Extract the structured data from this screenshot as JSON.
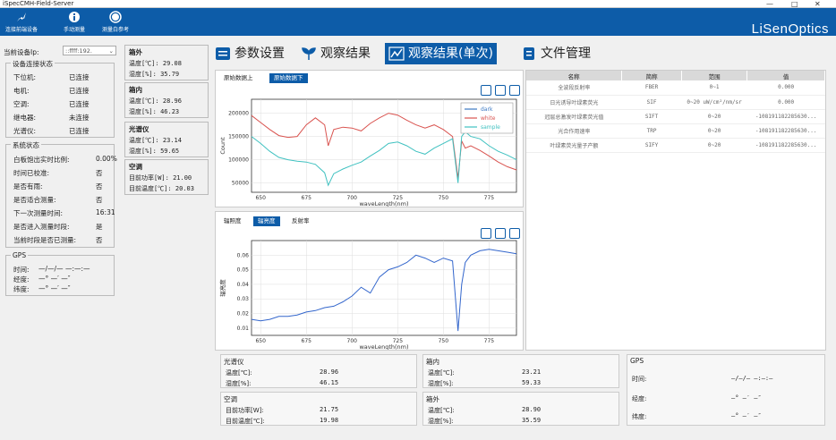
{
  "window": {
    "title": "iSpecCMH-Field-Server"
  },
  "toolbar": {
    "buttons": [
      {
        "label": "连接前端设备",
        "icon": "rocket-icon"
      },
      {
        "label": "手动测量",
        "icon": "info-icon"
      },
      {
        "label": "测量白参考",
        "icon": "circle-icon"
      }
    ],
    "logo": "LiSenOptics"
  },
  "device": {
    "label": "当前设备Ip:",
    "value": "::ffff:192."
  },
  "conn": {
    "title": "设备连接状态",
    "rows": [
      {
        "k": "下位机:",
        "v": "已连接"
      },
      {
        "k": "电机:",
        "v": "已连接"
      },
      {
        "k": "空调:",
        "v": "已连接"
      },
      {
        "k": "继电器:",
        "v": "未连接"
      },
      {
        "k": "光谱仪:",
        "v": "已连接"
      }
    ]
  },
  "sys": {
    "title": "系统状态",
    "rows": [
      {
        "k": "白板饱出实时比例:",
        "v": "0.00%"
      },
      {
        "k": "时间已校准:",
        "v": "否"
      },
      {
        "k": "是否有雨:",
        "v": "否"
      },
      {
        "k": "是否适合测量:",
        "v": "否"
      },
      {
        "k": "下一次测量时间:",
        "v": "16:31"
      },
      {
        "k": "是否进入测量时段:",
        "v": "是"
      },
      {
        "k": "当前时段是否已测量:",
        "v": "否"
      }
    ]
  },
  "gps_left": {
    "title": "GPS",
    "rows": [
      {
        "k": "时间:",
        "v": "—/—/— —:—:—"
      },
      {
        "k": "经度:",
        "v": "—° —′ —″"
      },
      {
        "k": "纬度:",
        "v": "—° —′ —″"
      }
    ]
  },
  "mid": {
    "outside": {
      "title": "箱外",
      "temp": "温度[℃]:   29.08",
      "hum": "湿度[%]:   35.79"
    },
    "inside": {
      "title": "箱内",
      "temp": "温度[℃]:   28.96",
      "hum": "湿度[%]:   46.23"
    },
    "spec": {
      "title": "光谱仪",
      "temp": "温度[℃]:   23.14",
      "hum": "湿度[%]:   59.65"
    },
    "ac": {
      "title": "空调",
      "power": "目前功率[W]:    21.00",
      "temp": "目前温度[℃]:   20.03"
    }
  },
  "tabs": [
    {
      "label": "参数设置",
      "icon": "sliders-icon"
    },
    {
      "label": "观察结果",
      "icon": "plant-icon"
    },
    {
      "label": "观察结果(单次)",
      "icon": "linechart-icon"
    },
    {
      "label": "文件管理",
      "icon": "file-icon"
    }
  ],
  "upper_chart": {
    "subtabs": [
      "原始数据上",
      "原始数据下"
    ],
    "legend": [
      "dark",
      "white",
      "sample"
    ]
  },
  "lower_chart": {
    "subtabs": [
      "辐照度",
      "辐亮度",
      "反射率"
    ]
  },
  "params_table": {
    "headers": [
      "名称",
      "简称",
      "范围",
      "值"
    ],
    "rows": [
      {
        "name": "全波段反射率",
        "abbr": "FBER",
        "range": "0~1",
        "value": "0.000"
      },
      {
        "name": "日光诱导叶绿素荧光",
        "abbr": "SIF",
        "range": "0~20 uW/cm²/nm/sr",
        "value": "0.000"
      },
      {
        "name": "冠层总激发叶绿素荧光值",
        "abbr": "SIFT",
        "range": "0~20",
        "value": "-108191182285630..."
      },
      {
        "name": "光合作用速率",
        "abbr": "TRP",
        "range": "0~20",
        "value": "-108191182285630..."
      },
      {
        "name": "叶绿素荧光量子产额",
        "abbr": "SIFY",
        "range": "0~20",
        "value": "-108191182285630..."
      }
    ]
  },
  "bottom": {
    "spec": {
      "title": "光谱仪",
      "r1k": "温度[℃]:",
      "r1v": "28.96",
      "r2k": "湿度[%]:",
      "r2v": "46.15"
    },
    "ac": {
      "title": "空调",
      "r1k": "目前功率[W]:",
      "r1v": "21.75",
      "r2k": "目前温度[℃]:",
      "r2v": "19.98"
    },
    "inside": {
      "title": "箱内",
      "r1k": "温度[℃]:",
      "r1v": "23.21",
      "r2k": "湿度[%]:",
      "r2v": "59.33"
    },
    "outside": {
      "title": "箱外",
      "r1k": "温度[℃]:",
      "r1v": "28.90",
      "r2k": "湿度[%]:",
      "r2v": "35.59"
    },
    "gps": {
      "title": "GPS",
      "r1k": "时间:",
      "r1v": "—/—/— —:—:—",
      "r2k": "经度:",
      "r2v": "—° —′ —″",
      "r3k": "纬度:",
      "r3v": "—° —′ —″"
    }
  },
  "colors": {
    "accent": "#0d5ca8",
    "dark": "#3a78c2",
    "white": "#d9534f",
    "sample": "#3fc1c0",
    "single": "#3366cc"
  },
  "chart_data": [
    {
      "type": "line",
      "xlabel": "waveLength(nm)",
      "ylabel": "Count",
      "xlim": [
        645,
        790
      ],
      "ylim": [
        30000,
        230000
      ],
      "xticks": [
        650,
        675,
        700,
        725,
        750,
        775
      ],
      "yticks": [
        50000,
        100000,
        150000,
        200000
      ],
      "series": [
        {
          "name": "white",
          "x": [
            645,
            650,
            655,
            660,
            665,
            670,
            675,
            680,
            685,
            687,
            690,
            695,
            700,
            705,
            710,
            715,
            720,
            725,
            730,
            735,
            740,
            745,
            750,
            755,
            758,
            760,
            762,
            765,
            770,
            775,
            780,
            785,
            790
          ],
          "y": [
            195000,
            180000,
            165000,
            152000,
            148000,
            150000,
            175000,
            190000,
            175000,
            130000,
            165000,
            170000,
            168000,
            162000,
            178000,
            190000,
            200000,
            196000,
            185000,
            175000,
            168000,
            175000,
            165000,
            150000,
            60000,
            140000,
            125000,
            130000,
            120000,
            108000,
            95000,
            85000,
            78000
          ]
        },
        {
          "name": "sample",
          "x": [
            645,
            650,
            655,
            660,
            665,
            670,
            675,
            680,
            685,
            687,
            690,
            695,
            700,
            705,
            710,
            715,
            720,
            725,
            730,
            735,
            740,
            745,
            750,
            755,
            758,
            760,
            762,
            765,
            770,
            775,
            780,
            785,
            790
          ],
          "y": [
            150000,
            135000,
            118000,
            105000,
            100000,
            97000,
            95000,
            90000,
            72000,
            45000,
            70000,
            80000,
            88000,
            95000,
            108000,
            120000,
            135000,
            138000,
            130000,
            118000,
            112000,
            125000,
            135000,
            145000,
            50000,
            150000,
            160000,
            150000,
            145000,
            130000,
            118000,
            110000,
            100000
          ]
        }
      ]
    },
    {
      "type": "line",
      "xlabel": "waveLength(nm)",
      "ylabel": "辐亮度",
      "xlim": [
        645,
        790
      ],
      "ylim": [
        0.005,
        0.07
      ],
      "xticks": [
        650,
        675,
        700,
        725,
        750,
        775
      ],
      "yticks": [
        0.01,
        0.02,
        0.03,
        0.04,
        0.05,
        0.06
      ],
      "series": [
        {
          "name": "radiance",
          "x": [
            645,
            650,
            655,
            660,
            665,
            670,
            675,
            680,
            685,
            690,
            695,
            700,
            705,
            710,
            715,
            720,
            725,
            730,
            735,
            740,
            745,
            750,
            755,
            758,
            760,
            762,
            765,
            770,
            775,
            780,
            785,
            790
          ],
          "y": [
            0.016,
            0.015,
            0.016,
            0.018,
            0.018,
            0.019,
            0.021,
            0.022,
            0.024,
            0.025,
            0.028,
            0.032,
            0.038,
            0.034,
            0.045,
            0.05,
            0.052,
            0.055,
            0.06,
            0.058,
            0.055,
            0.058,
            0.056,
            0.008,
            0.04,
            0.055,
            0.06,
            0.063,
            0.064,
            0.063,
            0.062,
            0.061
          ]
        }
      ]
    }
  ]
}
